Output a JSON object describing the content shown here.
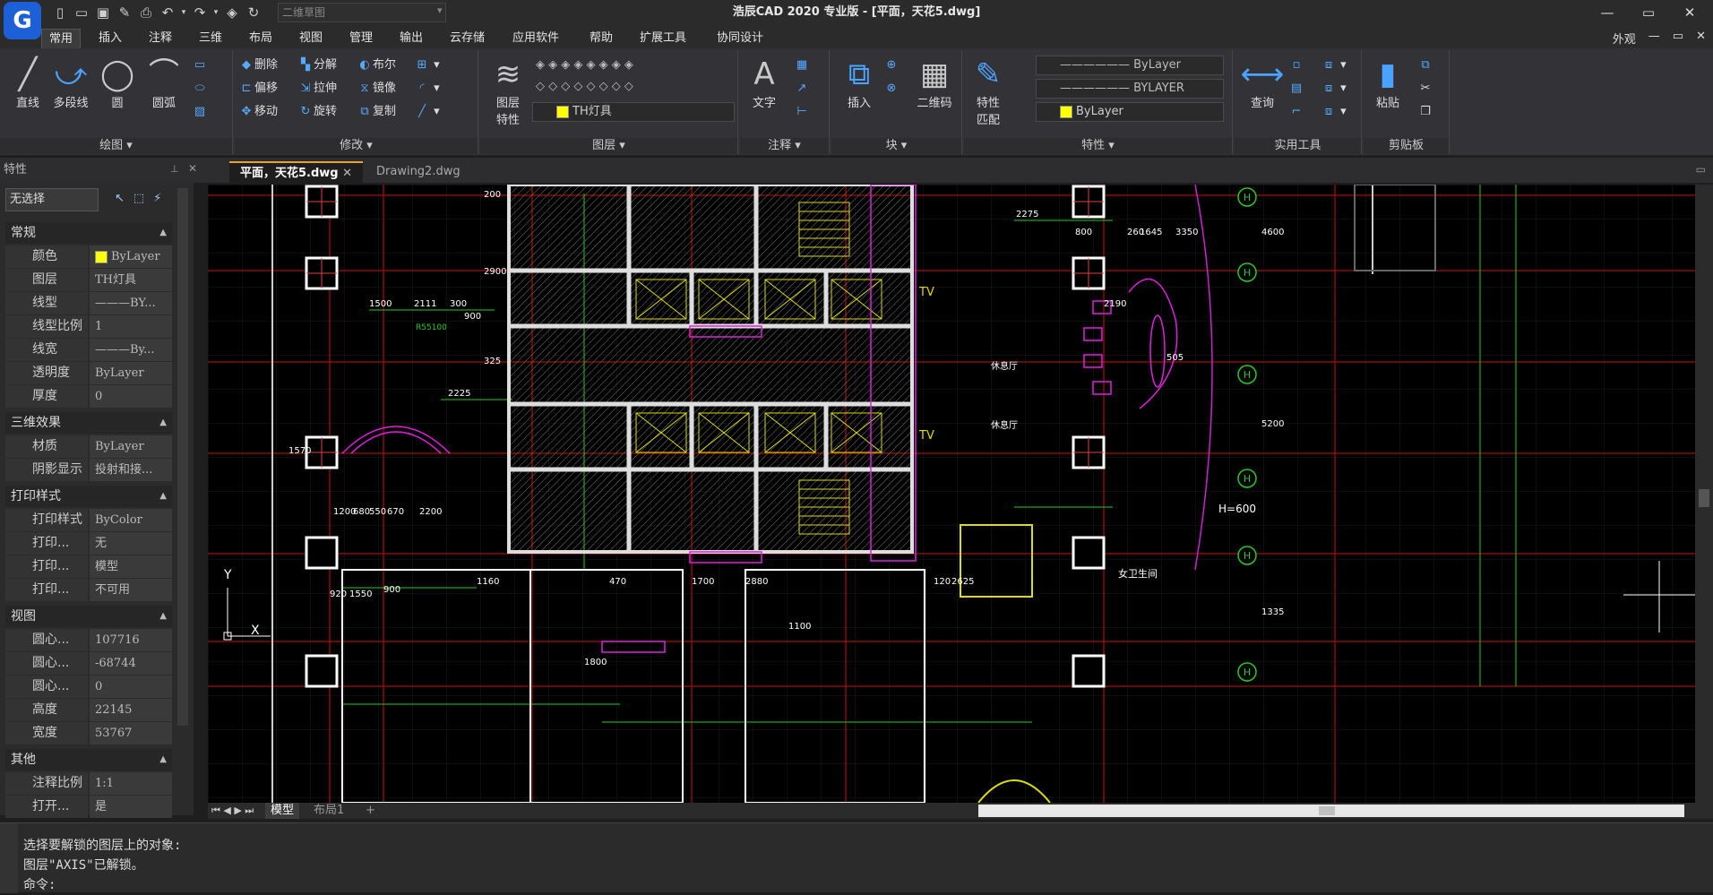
{
  "app": {
    "logo_letter": "G",
    "window_title": "浩辰CAD 2020 专业版 - [平面，天花5.dwg]",
    "workspace": "二维草图",
    "appearance_label": "外观",
    "window_buttons": [
      "—",
      "▭",
      "✕"
    ],
    "restore_buttons": [
      "—",
      "▭",
      "✕"
    ]
  },
  "menu_tabs": [
    "常用",
    "插入",
    "注释",
    "三维",
    "布局",
    "视图",
    "管理",
    "输出",
    "云存储",
    "应用软件",
    "帮助",
    "扩展工具",
    "协同设计"
  ],
  "ribbon": {
    "draw": {
      "label": "绘图",
      "line": "直线",
      "polyline": "多段线",
      "circle": "圆",
      "arc": "圆弧"
    },
    "modify": {
      "label": "修改",
      "delete": "删除",
      "explode": "分解",
      "boolean": "布尔",
      "offset": "偏移",
      "stretch": "拉伸",
      "mirror": "镜像",
      "move": "移动",
      "rotate": "旋转",
      "copy": "复制"
    },
    "layer": {
      "label": "图层",
      "properties_line1": "图层",
      "properties_line2": "特性",
      "current_layer": "TH灯具"
    },
    "annotation": {
      "label": "注释",
      "text": "文字"
    },
    "block": {
      "label": "块",
      "insert": "插入",
      "qrcode": "二维码"
    },
    "properties": {
      "label": "特性",
      "match_line1": "特性",
      "match_line2": "匹配",
      "linetype": "ByLayer",
      "lineweight": "BYLAYER",
      "color": "ByLayer"
    },
    "utilities": {
      "label": "实用工具",
      "query": "查询"
    },
    "clipboard": {
      "label": "剪贴板",
      "paste": "粘贴"
    }
  },
  "doc_tabs": {
    "properties_title": "特性",
    "active": "平面，天花5.dwg",
    "other": "Drawing2.dwg"
  },
  "properties_panel": {
    "selection": "无选择",
    "sections": {
      "general": "常规",
      "threed": "三维效果",
      "plot": "打印样式",
      "view": "视图",
      "misc": "其他"
    },
    "general": [
      {
        "k": "颜色",
        "v": "ByLayer"
      },
      {
        "k": "图层",
        "v": "TH灯具"
      },
      {
        "k": "线型",
        "v": "———BY..."
      },
      {
        "k": "线型比例",
        "v": "1"
      },
      {
        "k": "线宽",
        "v": "———By..."
      },
      {
        "k": "透明度",
        "v": "ByLayer"
      },
      {
        "k": "厚度",
        "v": "0"
      }
    ],
    "threed": [
      {
        "k": "材质",
        "v": "ByLayer"
      },
      {
        "k": "阴影显示",
        "v": "投射和接..."
      }
    ],
    "plot": [
      {
        "k": "打印样式",
        "v": "ByColor"
      },
      {
        "k": "打印...",
        "v": "无"
      },
      {
        "k": "打印...",
        "v": "模型"
      },
      {
        "k": "打印...",
        "v": "不可用"
      }
    ],
    "view": [
      {
        "k": "圆心...",
        "v": "107716"
      },
      {
        "k": "圆心...",
        "v": "-68744"
      },
      {
        "k": "圆心...",
        "v": "0"
      },
      {
        "k": "高度",
        "v": "22145"
      },
      {
        "k": "宽度",
        "v": "53767"
      }
    ],
    "misc": [
      {
        "k": "注释比例",
        "v": "1:1"
      },
      {
        "k": "打开...",
        "v": "是"
      }
    ]
  },
  "drawing": {
    "dims": [
      "1500",
      "2111",
      "300",
      "900",
      "2225",
      "1570",
      "1200",
      "680",
      "550",
      "670",
      "2200",
      "1160",
      "900",
      "920",
      "1550",
      "1700",
      "2880",
      "470",
      "1100",
      "1800",
      "2275",
      "2190",
      "800",
      "260",
      "1645",
      "3350",
      "4600",
      "5200",
      "1335",
      "505",
      "120",
      "2625",
      "2900",
      "325",
      "200"
    ],
    "labels": [
      "TV",
      "TV",
      "休息厅",
      "休息厅",
      "H=600",
      "女卫生间",
      "R55100",
      "Y",
      "X"
    ],
    "axis_markers": [
      "H",
      "H",
      "H",
      "H",
      "H",
      "H"
    ]
  },
  "layout_tabs": [
    "模型",
    "布局1",
    "+"
  ],
  "command": {
    "line1": "选择要解锁的图层上的对象:",
    "line2": "图层\"AXIS\"已解锁。",
    "prompt": "命令:"
  }
}
